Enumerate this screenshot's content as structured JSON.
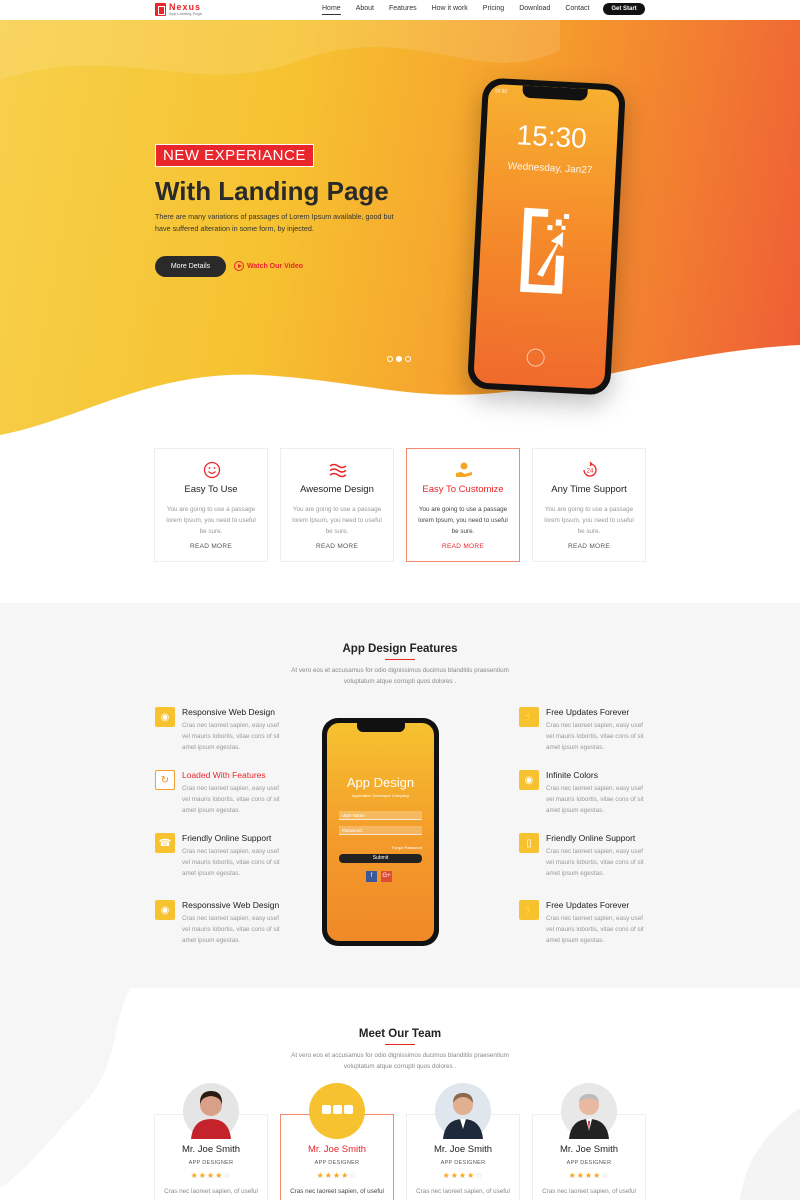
{
  "brand": {
    "name": "Nexus",
    "tagline": "App Landing Page"
  },
  "nav": {
    "items": [
      "Home",
      "About",
      "Features",
      "How it work",
      "Pricing",
      "Download",
      "Contact"
    ],
    "active": "Home",
    "cta": "Get Start"
  },
  "hero": {
    "badge": "NEW EXPERIANCE",
    "title": "With Landing Page",
    "description": "There are many variations of passages of Lorem Ipsum available, good but have suffered alteration in some form, by injected.",
    "primary_button": "More Details",
    "video_link": "Watch Our Video",
    "slides_total": 3,
    "slide_active": 2,
    "phone": {
      "status_time": "15:30",
      "clock": "15:30",
      "date": "Wednesday, Jan27"
    }
  },
  "services": [
    {
      "title": "Easy To Use",
      "text": "You are going to use a passage lorem Ipsum, you need to useful be sure.",
      "link": "READ MORE",
      "icon": "smile-icon",
      "active": false
    },
    {
      "title": "Awesome Design",
      "text": "You are going to use a passage lorem Ipsum, you need to useful be sure.",
      "link": "READ MORE",
      "icon": "waves-icon",
      "active": false
    },
    {
      "title": "Easy To Customize",
      "text": "You are going to use a passage lorem Ipsum, you need to useful be sure.",
      "link": "READ MORE",
      "icon": "hand-gear-icon",
      "active": true
    },
    {
      "title": "Any Time Support",
      "text": "You are going to use a passage lorem Ipsum, you need to useful be sure.",
      "link": "READ MORE",
      "icon": "support-24-icon",
      "active": false
    }
  ],
  "app_features": {
    "title": "App Design Features",
    "subtitle": "At vero eos et accusamus for odio dignissimos ducimus blanditiis praesentium voluptatum atque corrupti quos dolores .",
    "left": [
      {
        "title": "Responsive Web Design",
        "text": "Cras nec laoreet sapien, easy usef vel mauris lobortis, vitae cons of sit amet ipsum egestas.",
        "icon": "globe-icon"
      },
      {
        "title": "Loaded With Features",
        "text": "Cras nec laoreet sapien, easy usef vel mauris lobortis, vitae cons of sit amet ipsum egestas.",
        "icon": "refresh-icon"
      },
      {
        "title": "Friendly Online Support",
        "text": "Cras nec laoreet sapien, easy usef vel mauris lobortis, vitae cons of sit amet ipsum egestas.",
        "icon": "support-icon"
      },
      {
        "title": "Responssive Web Design",
        "text": "Cras nec laoreet sapien, easy usef vel mauris lobortis, vitae cons of sit amet ipsum egestas.",
        "icon": "globe-icon"
      }
    ],
    "right": [
      {
        "title": "Free Updates Forever",
        "text": "Cras nec laoreet sapien, easy usef vel mauris lobortis, vitae cons of sit amet ipsum egestas.",
        "icon": "bolt-icon"
      },
      {
        "title": "Infinite Colors",
        "text": "Cras nec laoreet sapien, easy usef vel mauris lobortis, vitae cons of sit amet ipsum egestas.",
        "icon": "palette-icon"
      },
      {
        "title": "Friendly Online Support",
        "text": "Cras nec laoreet sapien, easy usef vel mauris lobortis, vitae cons of sit amet ipsum egestas.",
        "icon": "mobile-icon"
      },
      {
        "title": "Free Updates Forever",
        "text": "Cras nec laoreet sapien, easy usef vel mauris lobortis, vitae cons of sit amet ipsum egestas.",
        "icon": "bolt-icon"
      }
    ],
    "phone": {
      "title": "App Design",
      "subtitle": "Application Developer Company",
      "username_placeholder": "User Name",
      "password_placeholder": "Password",
      "forgot": "Forgot Password",
      "submit": "Submit",
      "social": [
        "f",
        "G+"
      ]
    }
  },
  "team": {
    "title": "Meet Our Team",
    "subtitle": "At vero eos et accusamus for odio dignissimos ducimus blanditiis praesentium voluptatum atque corrupti quos dolores .",
    "members": [
      {
        "name": "Mr. Joe Smith",
        "role": "APP DESIGNER",
        "rating": 4,
        "text": "Cras nec laoreet sapien, of useful",
        "active": false
      },
      {
        "name": "Mr. Joe Smith",
        "role": "APP DESIGNER",
        "rating": 4,
        "text": "Cras nec laoreet sapien, of useful",
        "active": true
      },
      {
        "name": "Mr. Joe Smith",
        "role": "APP DESIGNER",
        "rating": 4,
        "text": "Cras nec laoreet sapien, of useful",
        "active": false
      },
      {
        "name": "Mr. Joe Smith",
        "role": "APP DESIGNER",
        "rating": 4,
        "text": "Cras nec laoreet sapien, of useful",
        "active": false
      }
    ]
  },
  "colors": {
    "accent": "#e8262b",
    "yellow": "#f6c230",
    "orange": "#f08a28",
    "dark": "#2a2a2a"
  }
}
